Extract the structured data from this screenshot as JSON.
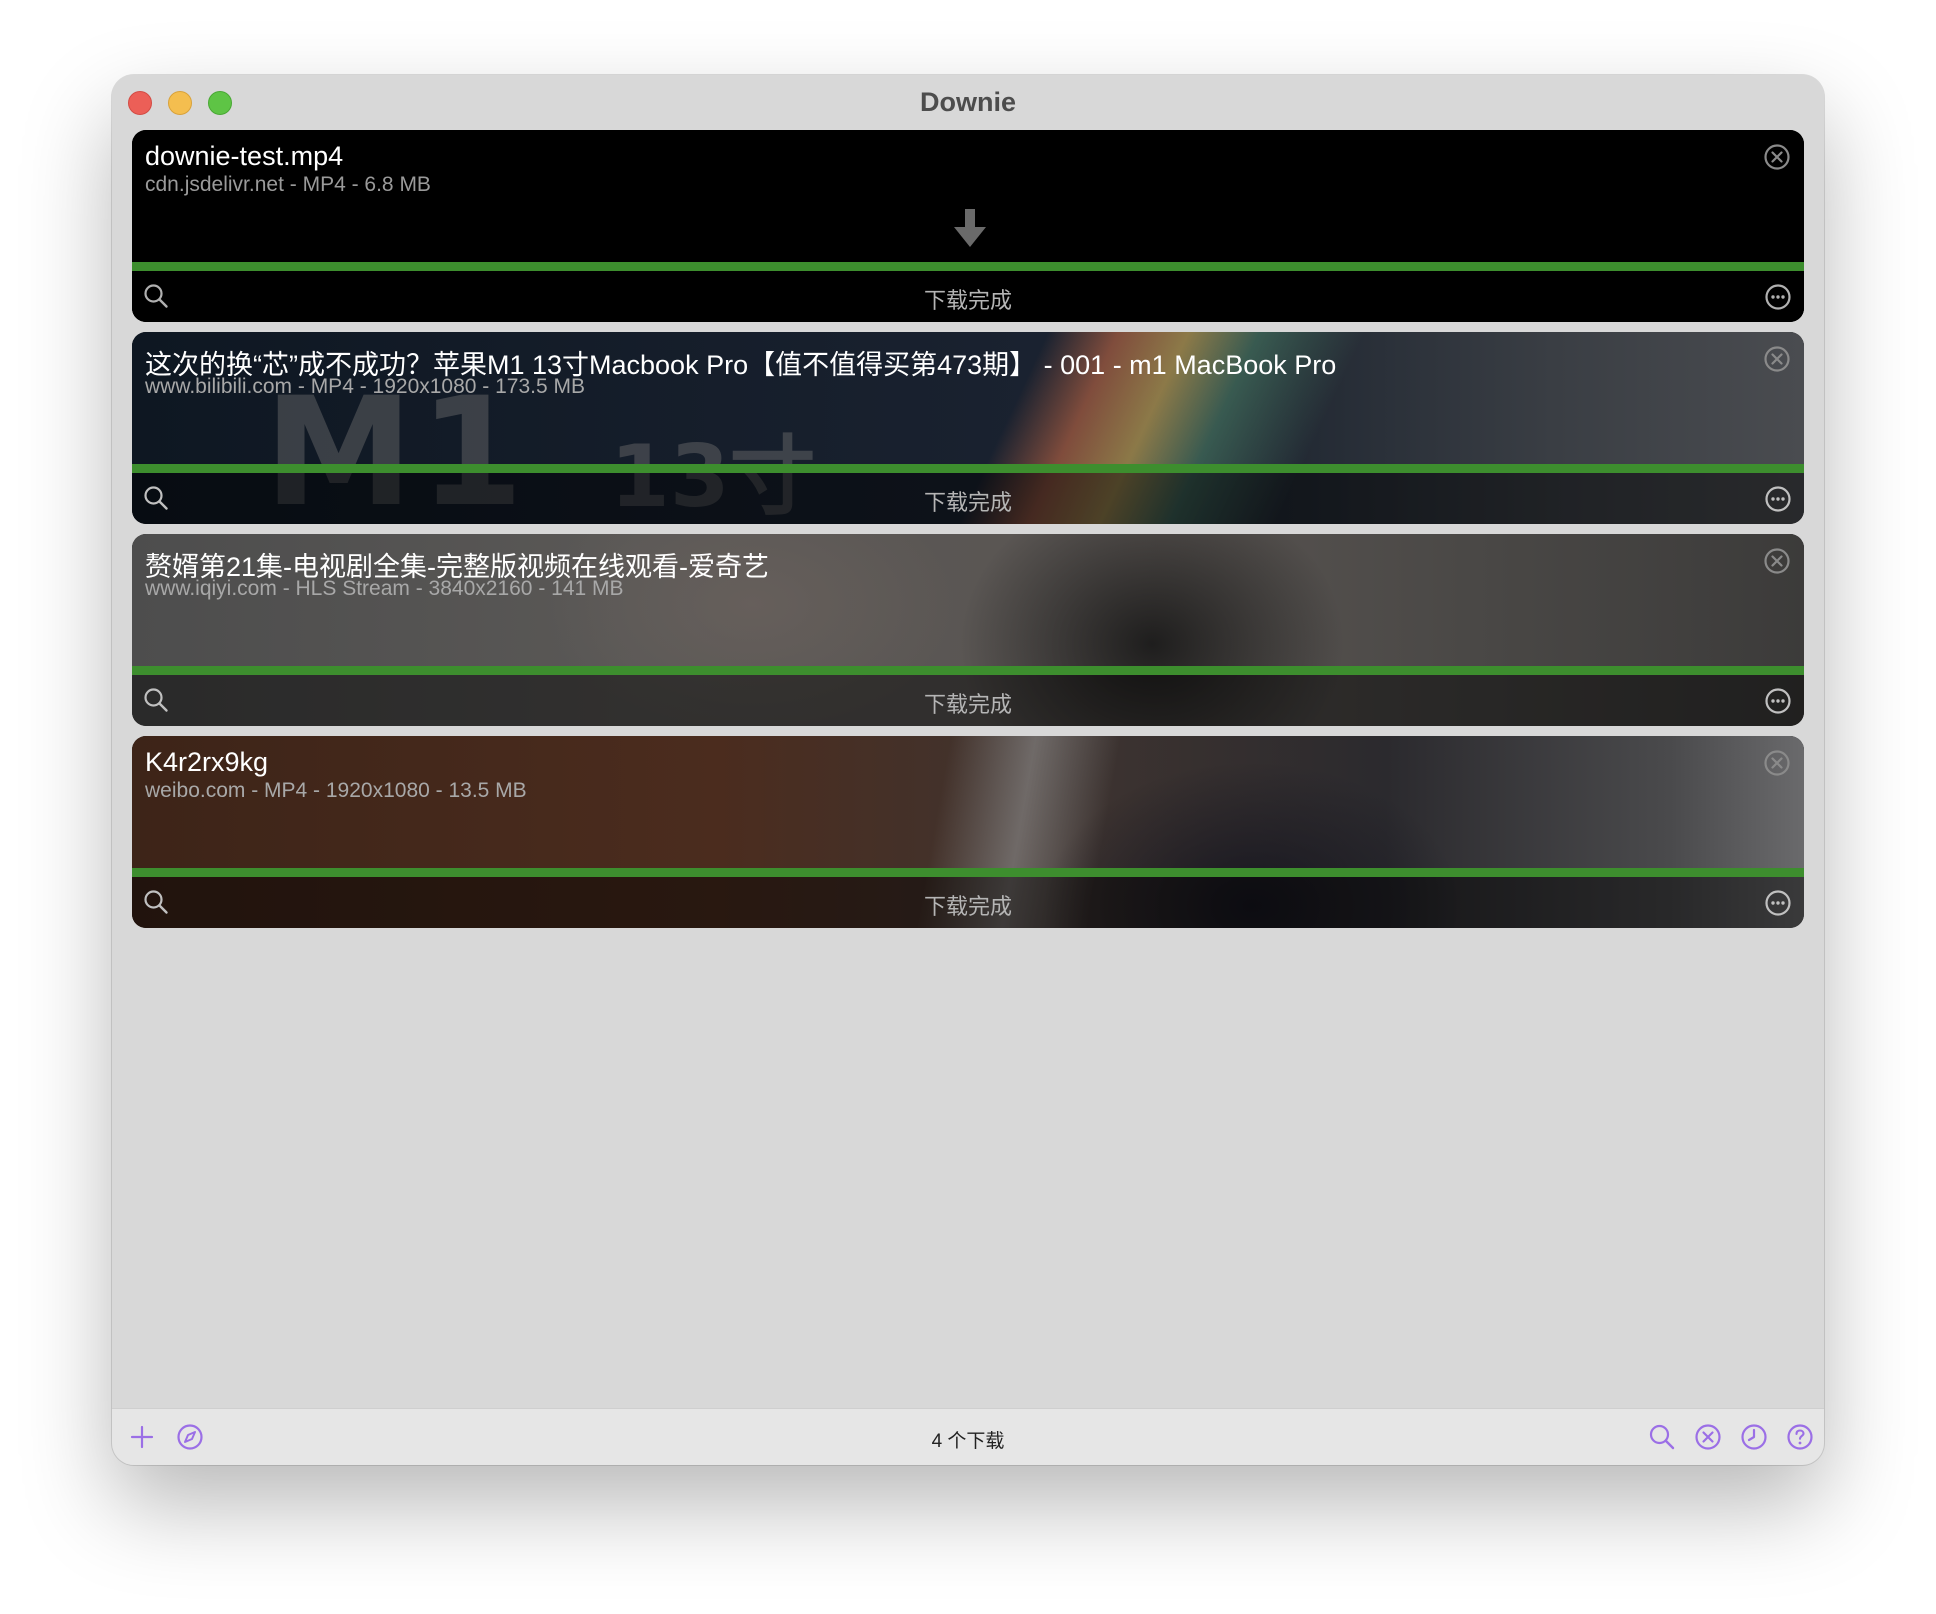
{
  "window": {
    "title": "Downie"
  },
  "downloads": [
    {
      "title": "downie-test.mp4",
      "meta": "cdn.jsdelivr.net - MP4 - 6.8 MB",
      "status": "下载完成",
      "progress": 1.0
    },
    {
      "title": "这次的换“芯”成不成功？苹果M1 13寸Macbook Pro【值不值得买第473期】 - 001 - m1 MacBook Pro",
      "meta": "www.bilibili.com - MP4 - 1920x1080 - 173.5 MB",
      "status": "下载完成",
      "progress": 1.0,
      "thumbnail_text": [
        "M1",
        "13寸"
      ]
    },
    {
      "title": "赘婿第21集-电视剧全集-完整版视频在线观看-爱奇艺",
      "meta": "www.iqiyi.com - HLS Stream - 3840x2160 - 141 MB",
      "status": "下载完成",
      "progress": 1.0
    },
    {
      "title": "K4r2rx9kg",
      "meta": "weibo.com - MP4 - 1920x1080 - 13.5 MB",
      "status": "下载完成",
      "progress": 1.0
    }
  ],
  "footer": {
    "count_label": "4 个下载"
  },
  "icons": {
    "card_close": "close-circle-icon",
    "card_search": "search-icon",
    "card_more": "more-circle-icon",
    "download_arrow": "download-arrow-icon",
    "footer_add": "plus-icon",
    "footer_browser": "compass-icon",
    "footer_search": "search-icon",
    "footer_cancel_all": "close-circle-icon",
    "footer_history": "clock-icon",
    "footer_help": "help-icon"
  },
  "colors": {
    "progress": "#3d8e2e",
    "accent": "#9b6fe6",
    "window_bg": "#d8d8d8"
  }
}
